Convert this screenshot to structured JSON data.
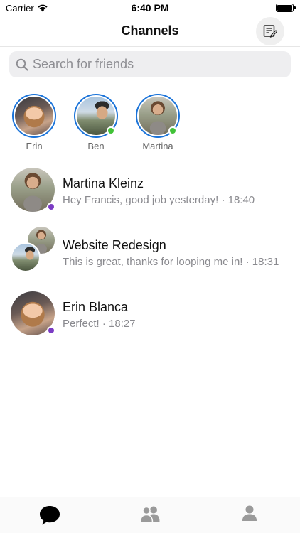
{
  "status_bar": {
    "carrier": "Carrier",
    "time": "6:40 PM"
  },
  "nav": {
    "title": "Channels",
    "compose_icon": "compose-icon"
  },
  "search": {
    "placeholder": "Search for friends",
    "value": ""
  },
  "stories": [
    {
      "name": "Erin",
      "online": false
    },
    {
      "name": "Ben",
      "online": true
    },
    {
      "name": "Martina",
      "online": true
    }
  ],
  "conversations": [
    {
      "title": "Martina Kleinz",
      "preview": "Hey Francis, good job yesterday! · 18:40",
      "unread": true
    },
    {
      "title": "Website Redesign",
      "preview": "This is great, thanks for looping me in! · 18:31",
      "unread": false
    },
    {
      "title": "Erin Blanca",
      "preview": "Perfect! · 18:27",
      "unread": true
    }
  ],
  "tabs": [
    {
      "icon": "chat-bubble-icon",
      "active": true
    },
    {
      "icon": "friends-icon",
      "active": false
    },
    {
      "icon": "profile-icon",
      "active": false
    }
  ],
  "colors": {
    "ring": "#1a73d9",
    "online": "#41c237",
    "unread": "#7b3cc4",
    "tab_active": "#000000",
    "tab_inactive": "#9a9a9a"
  }
}
